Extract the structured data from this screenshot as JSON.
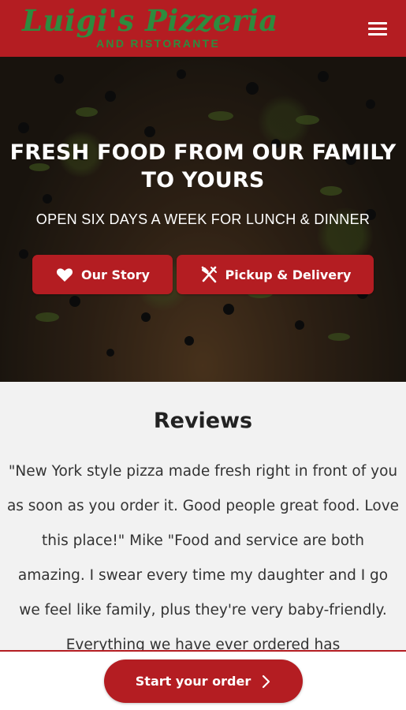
{
  "header": {
    "logo_script": "Luigi's Pizzeria",
    "logo_subtitle": "AND RISTORANTE",
    "menu_icon": "hamburger-menu-icon"
  },
  "hero": {
    "title_line1": "FRESH FOOD FROM OUR FAMILY",
    "title_line2": "TO YOURS",
    "subtitle": "OPEN SIX DAYS A WEEK FOR LUNCH & DINNER",
    "buttons": [
      {
        "label": "Our Story",
        "icon": "heart-icon"
      },
      {
        "label": "Pickup & Delivery",
        "icon": "utensils-icon"
      }
    ]
  },
  "reviews": {
    "title": "Reviews",
    "text": "\"New York style pizza made fresh right in front of you as soon as you order it. Good people great food. Love this place!\" Mike \"Food and service are both amazing. I swear every time my daughter and I go we feel like family, plus they're very baby-friendly. Everything we have ever ordered has"
  },
  "footer": {
    "cta_label": "Start your order",
    "cta_icon": "chevron-right-icon"
  },
  "colors": {
    "brand_red": "#b41d22",
    "logo_green": "#2e8b3e",
    "background": "#f2f2f2"
  }
}
